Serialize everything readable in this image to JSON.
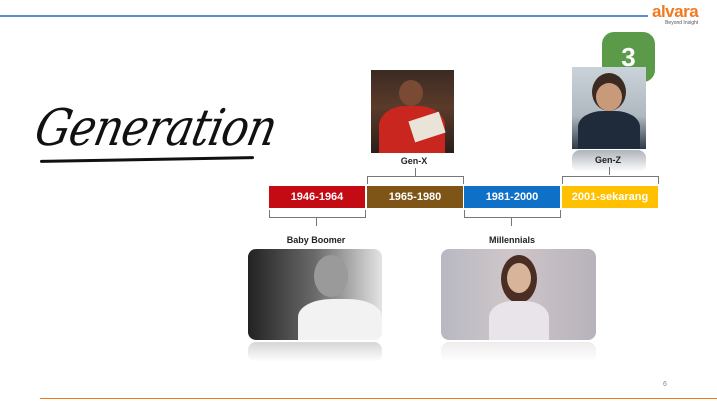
{
  "logo": {
    "name": "alvara",
    "tagline": "Beyond Insight"
  },
  "slide": {
    "badge_number": "3",
    "title": "Generation",
    "page_number": "6"
  },
  "timeline": {
    "periods": [
      {
        "range": "1946-1964",
        "generation": "Baby Boomer",
        "color": "#c40a12"
      },
      {
        "range": "1965-1980",
        "generation": "Gen-X",
        "color": "#7f5417"
      },
      {
        "range": "1981-2000",
        "generation": "Millennials",
        "color": "#0f70c8"
      },
      {
        "range": "2001-sekarang",
        "generation": "Gen-Z",
        "color": "#ffc000"
      }
    ]
  },
  "colors": {
    "accent_orange": "#f07a22",
    "rule_blue": "#5a8fd0",
    "badge_green": "#5a9a48"
  }
}
